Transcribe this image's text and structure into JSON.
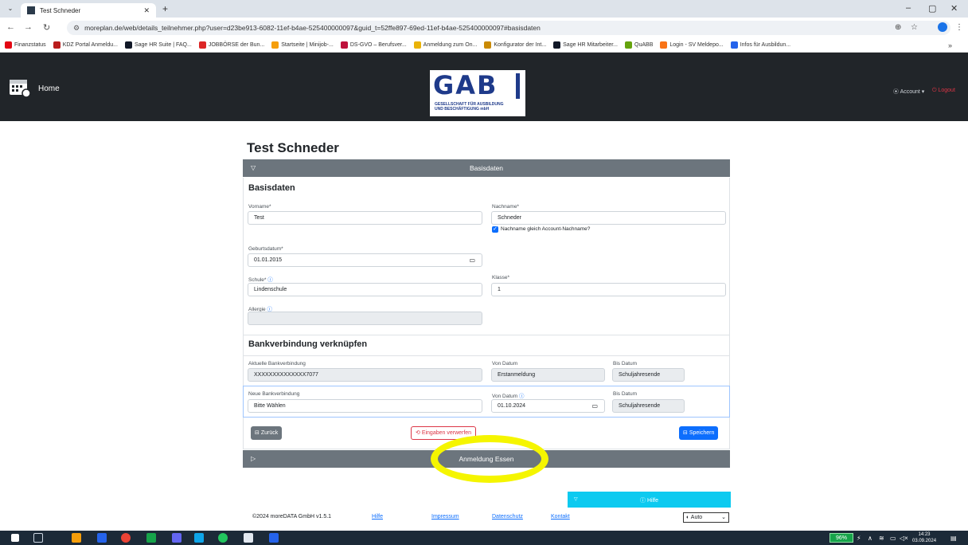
{
  "browser": {
    "tab_title": "Test Schneder",
    "url": "moreplan.de/web/details_teilnehmer.php?user=d23be913-6082-11ef-b4ae-525400000097&guid_t=52ffe897-69ed-11ef-b4ae-525400000097#basisdaten",
    "bookmarks": [
      {
        "label": "Finanzstatus",
        "color": "#e30613"
      },
      {
        "label": "KDZ Portal Anmeldu...",
        "color": "#b91c1c"
      },
      {
        "label": "Sage HR Suite | FAQ...",
        "color": "#111827"
      },
      {
        "label": "JOBBÖRSE der Bun...",
        "color": "#dc2626"
      },
      {
        "label": "Startseite | Minijob-...",
        "color": "#f59e0b"
      },
      {
        "label": "DS-GVO – Berufsver...",
        "color": "#be123c"
      },
      {
        "label": "Anmeldung zum On...",
        "color": "#eab308"
      },
      {
        "label": "Konfigurator der Int...",
        "color": "#ca8a04"
      },
      {
        "label": "Sage HR Mitarbeiter...",
        "color": "#111827"
      },
      {
        "label": "QuABB",
        "color": "#65a30d"
      },
      {
        "label": "Login - SV Meldepo...",
        "color": "#f97316"
      },
      {
        "label": "Infos für Ausbildun...",
        "color": "#2563eb"
      }
    ]
  },
  "nav": {
    "home_label": "Home",
    "logo_text": "GAB",
    "logo_line1": "GESELLSCHAFT FÜR AUSBILDUNG",
    "logo_line2": "UND BESCHÄFTIGUNG mbH",
    "account_label": "Account ▾",
    "logout_label": "Logout"
  },
  "page": {
    "title": "Test Schneder",
    "accordion_basisdaten": "Basisdaten",
    "accordion_essen": "Anmeldung Essen",
    "basis": {
      "heading": "Basisdaten",
      "vorname_label": "Vorname*",
      "vorname_value": "Test",
      "nachname_label": "Nachname*",
      "nachname_value": "Schneder",
      "nachname_check_label": "Nachname gleich Account-Nachname?",
      "geburtsdatum_label": "Geburtsdatum*",
      "geburtsdatum_value": "01.01.2015",
      "schule_label": "Schule*",
      "schule_value": "Lindenschule",
      "klasse_label": "Klasse*",
      "klasse_value": "1",
      "allergie_label": "Allergie",
      "allergie_value": ""
    },
    "bank": {
      "heading": "Bankverbindung verknüpfen",
      "aktuelle_label": "Aktuelle Bankverbindung",
      "aktuelle_value": "XXXXXXXXXXXXXX7077",
      "von_label": "Von Datum",
      "von_value": "Erstanmeldung",
      "bis_label": "Bis Datum",
      "bis_value": "Schuljahresende",
      "neue_label": "Neue Bankverbindung",
      "neue_value": "Bitte Wählen",
      "neue_von_label": "Von Datum",
      "neue_von_value": "01.10.2024",
      "neue_bis_label": "Bis Datum",
      "neue_bis_value": "Schuljahresende"
    },
    "buttons": {
      "back": "Zurück",
      "discard": "Eingaben verwerfen",
      "save": "Speichern"
    },
    "help_label": "Hilfe"
  },
  "footer": {
    "copyright": "©2024 moreDATA GmbH v1.5.1",
    "links": [
      "Hilfe",
      "Impressum",
      "Datenschutz",
      "Kontakt"
    ],
    "theme_value": "◐ Auto"
  },
  "taskbar": {
    "battery": "96%",
    "time": "14:23",
    "date": "03.09.2024"
  }
}
